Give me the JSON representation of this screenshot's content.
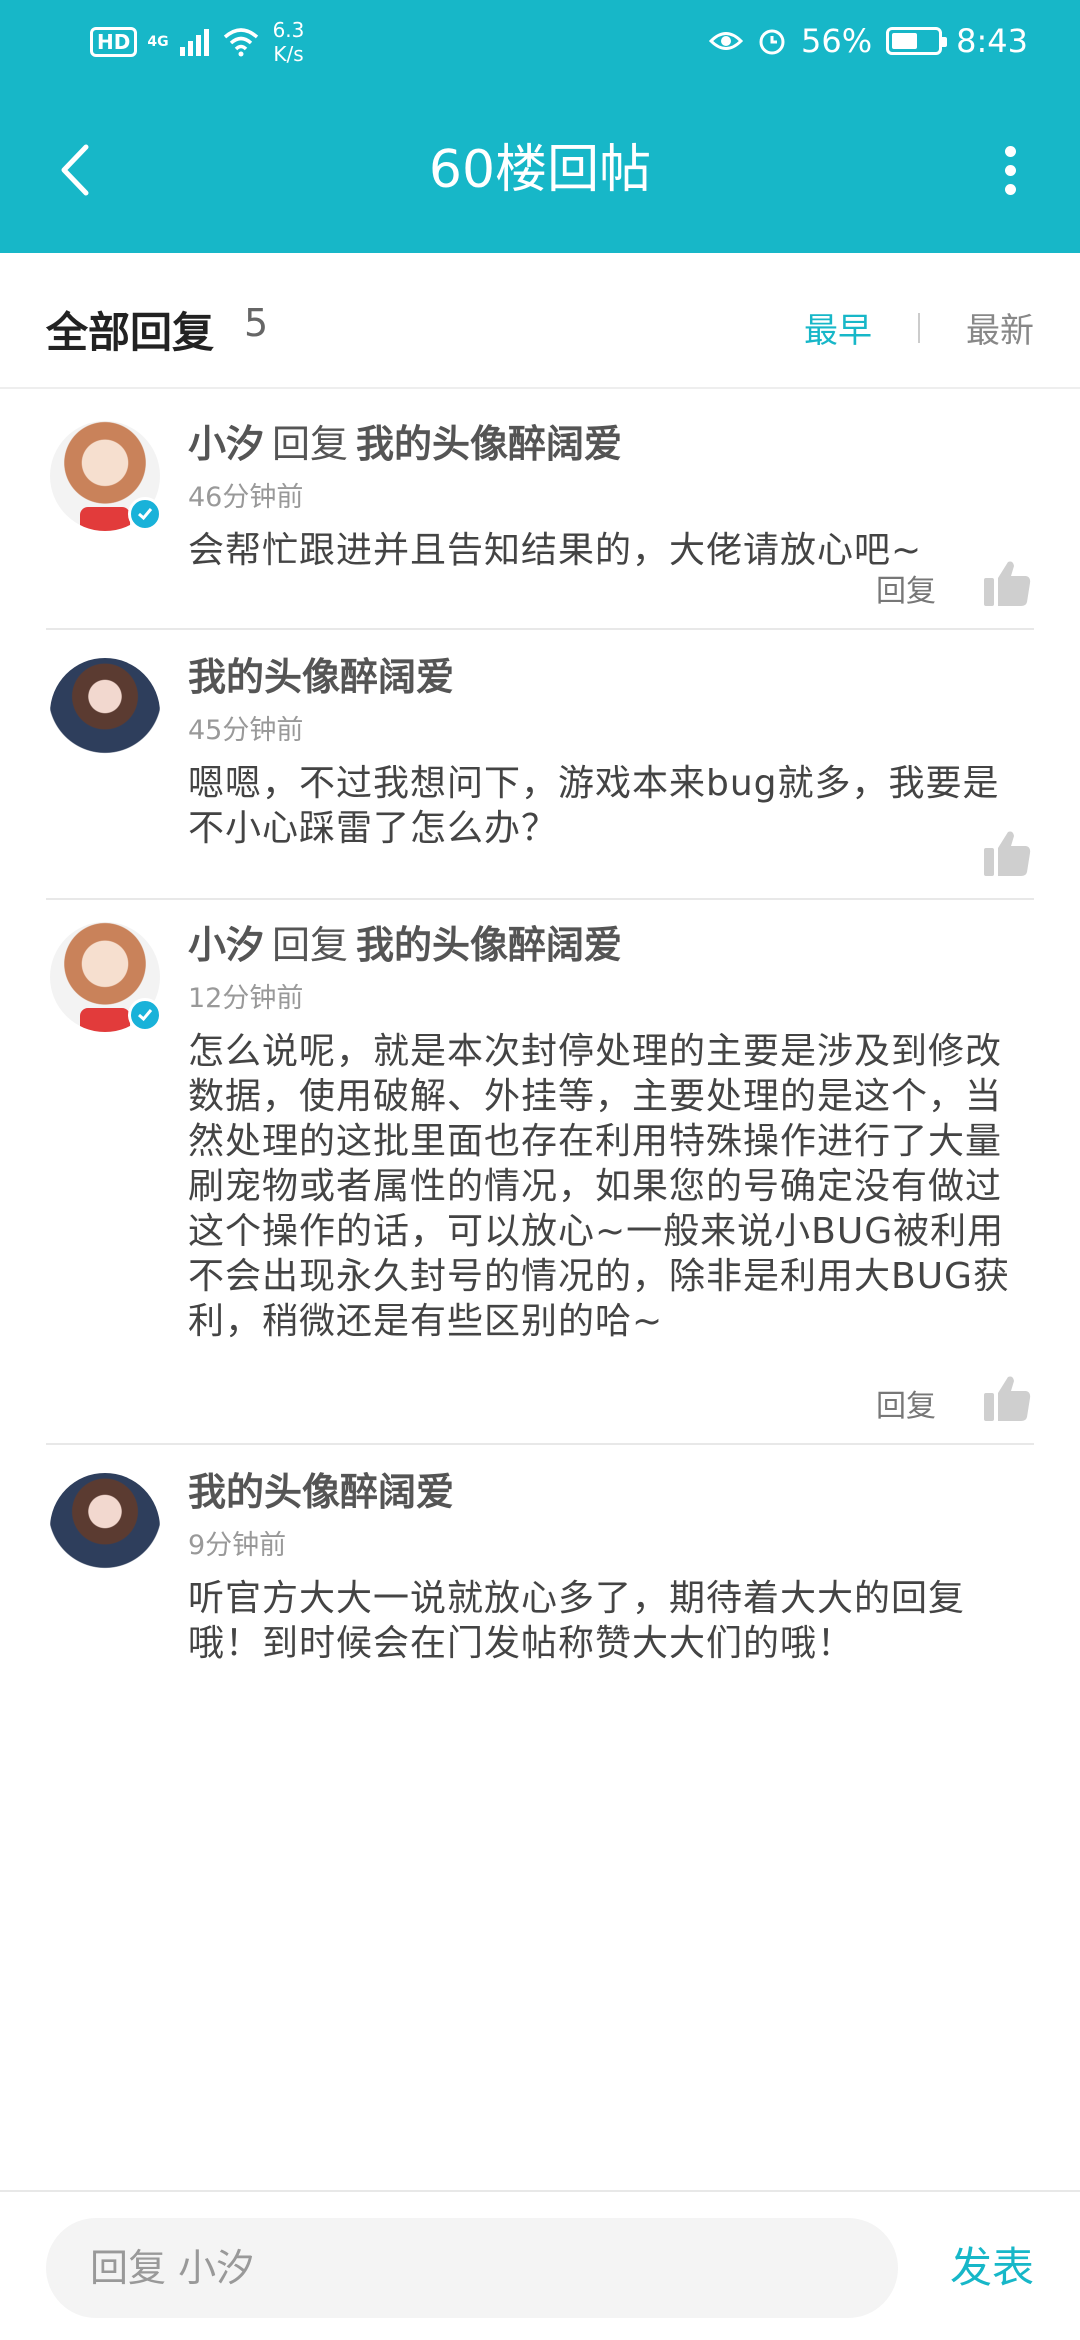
{
  "status_bar": {
    "hd": "HD",
    "network": "4G",
    "speed_value": "6.3",
    "speed_unit": "K/s",
    "battery": "56%",
    "battery_level": 0.56,
    "time": "8:43",
    "icons": [
      "eye-icon",
      "alarm-icon",
      "battery-icon",
      "wifi-icon",
      "signal-icon"
    ]
  },
  "appbar": {
    "title": "60楼回帖",
    "back_icon": "back-arrow-icon",
    "more_icon": "more-vertical-icon"
  },
  "header": {
    "title": "全部回复",
    "count": "5",
    "sort_earliest": "最早",
    "sort_newest": "最新",
    "accent": "#17b7c8"
  },
  "comments": [
    {
      "author": "小汐",
      "reply_word": "回复",
      "reply_to": "我的头像醉阔爱",
      "time": "46分钟前",
      "text": "会帮忙跟进并且告知结果的，大佬请放心吧~",
      "reply_label": "回复",
      "verified": true
    },
    {
      "author": "我的头像醉阔爱",
      "reply_word": "",
      "reply_to": "",
      "time": "45分钟前",
      "text": "嗯嗯，不过我想问下，游戏本来bug就多，我要是不小心踩雷了怎么办？",
      "reply_label": "",
      "verified": false
    },
    {
      "author": "小汐",
      "reply_word": "回复",
      "reply_to": "我的头像醉阔爱",
      "time": "12分钟前",
      "text": "怎么说呢，就是本次封停处理的主要是涉及到修改数据，使用破解、外挂等，主要处理的是这个，当然处理的这批里面也存在利用特殊操作进行了大量刷宠物或者属性的情况，如果您的号确定没有做过这个操作的话，可以放心~一般来说小BUG被利用不会出现永久封号的情况的，除非是利用大BUG获利，稍微还是有些区别的哈~",
      "reply_label": "回复",
      "verified": true
    },
    {
      "author": "我的头像醉阔爱",
      "reply_word": "",
      "reply_to": "",
      "time": "9分钟前",
      "text": "听官方大大一说就放心多了，期待着大大的回复哦！到时候会在门发帖称赞大大们的哦！",
      "reply_label": "",
      "verified": false
    }
  ],
  "bottom": {
    "placeholder": "回复 小汐",
    "send_label": "发表"
  }
}
